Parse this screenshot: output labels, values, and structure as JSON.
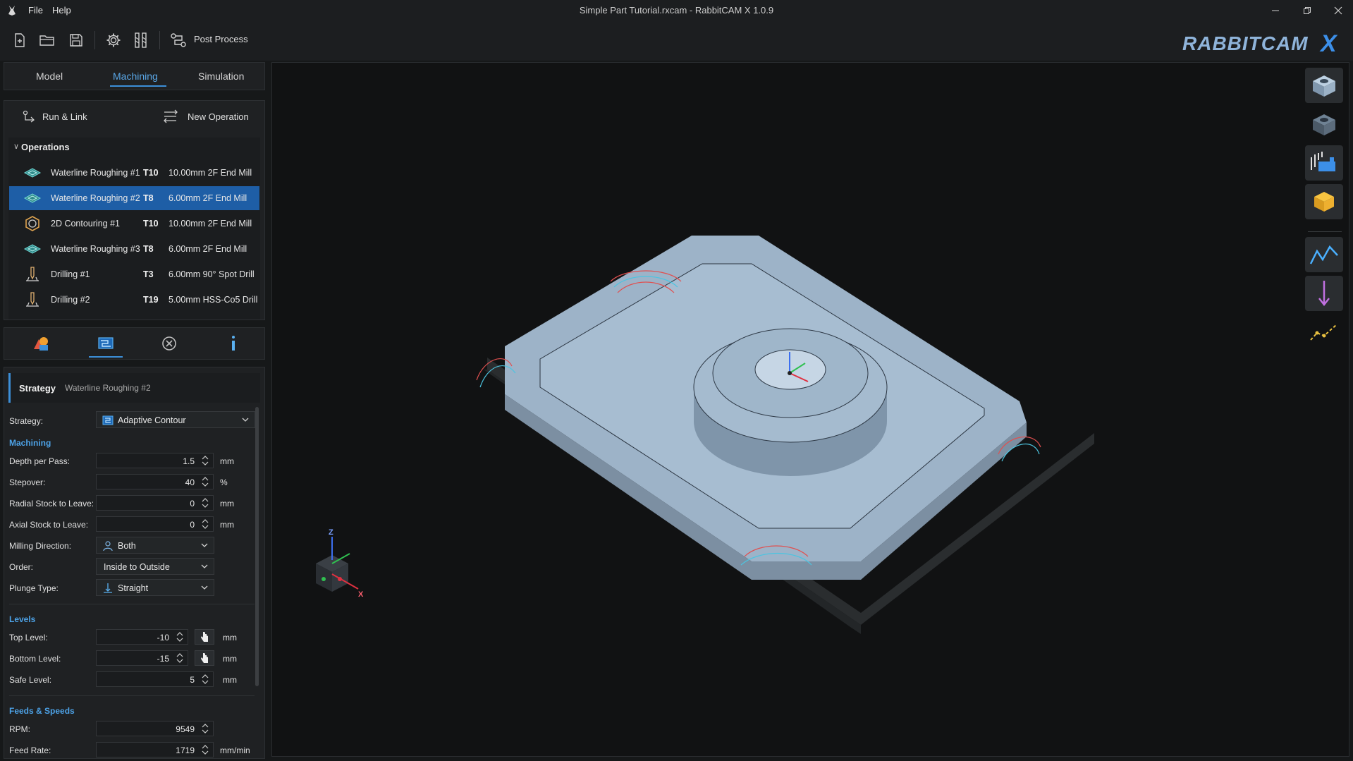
{
  "window": {
    "title": "Simple Part Tutorial.rxcam - RabbitCAM X 1.0.9",
    "menu": [
      "File",
      "Help"
    ],
    "controls": [
      "minimize",
      "restore",
      "close"
    ]
  },
  "toolbar": {
    "buttons": [
      "new-file-icon",
      "open-folder-icon",
      "save-icon",
      "settings-gear-icon",
      "tool-library-icon",
      "post-process-icon"
    ],
    "post_process_label": "Post Process",
    "logo_text": "RABBITCAM",
    "logo_suffix": "X"
  },
  "tabs": [
    "Model",
    "Machining",
    "Simulation"
  ],
  "active_tab": "Machining",
  "operations_panel": {
    "run_link_label": "Run & Link",
    "new_operation_label": "New Operation",
    "header": "Operations",
    "rows": [
      {
        "name": "Waterline Roughing #1",
        "tool": "T10",
        "desc": "10.00mm 2F End Mill",
        "icon": "waterline-icon",
        "selected": false
      },
      {
        "name": "Waterline Roughing #2",
        "tool": "T8",
        "desc": "6.00mm 2F End Mill",
        "icon": "waterline-icon",
        "selected": true
      },
      {
        "name": "2D Contouring #1",
        "tool": "T10",
        "desc": "10.00mm 2F End Mill",
        "icon": "contour-icon",
        "selected": false
      },
      {
        "name": "Waterline Roughing #3",
        "tool": "T8",
        "desc": "6.00mm 2F End Mill",
        "icon": "waterline-icon",
        "selected": false
      },
      {
        "name": "Drilling #1",
        "tool": "T3",
        "desc": "6.00mm 90° Spot Drill",
        "icon": "drill-icon",
        "selected": false
      },
      {
        "name": "Drilling #2",
        "tool": "T19",
        "desc": "5.00mm HSS-Co5 Drill",
        "icon": "drill-icon",
        "selected": false
      }
    ]
  },
  "icon_tabs": [
    "geometry-icon",
    "strategy-icon",
    "boundary-icon",
    "tool-icon"
  ],
  "strategy_panel": {
    "title": "Strategy",
    "subtitle": "Waterline Roughing #2",
    "strategy_label": "Strategy:",
    "strategy_value": "Adaptive Contour",
    "sections": {
      "machining": "Machining",
      "levels": "Levels",
      "feeds": "Feeds & Speeds"
    },
    "fields": {
      "depth": {
        "label": "Depth per Pass:",
        "value": "1.5",
        "unit": "mm"
      },
      "stepover": {
        "label": "Stepover:",
        "value": "40",
        "unit": "%"
      },
      "radial": {
        "label": "Radial Stock to Leave:",
        "value": "0",
        "unit": "mm"
      },
      "axial": {
        "label": "Axial Stock to Leave:",
        "value": "0",
        "unit": "mm"
      },
      "milling_dir": {
        "label": "Milling Direction:",
        "value": "Both"
      },
      "order": {
        "label": "Order:",
        "value": "Inside to Outside"
      },
      "plunge": {
        "label": "Plunge Type:",
        "value": "Straight"
      },
      "top": {
        "label": "Top Level:",
        "value": "-10",
        "unit": "mm"
      },
      "bottom": {
        "label": "Bottom Level:",
        "value": "-15",
        "unit": "mm"
      },
      "safe": {
        "label": "Safe Level:",
        "value": "5",
        "unit": "mm"
      },
      "rpm": {
        "label": "RPM:",
        "value": "9549"
      },
      "feed": {
        "label": "Feed Rate:",
        "value": "1719",
        "unit": "mm/min"
      }
    }
  },
  "viewport": {
    "axis_labels": {
      "z": "Z",
      "x": "X"
    }
  },
  "right_toolbar": [
    "stock-view-icon",
    "model-view-icon",
    "fixture-icon",
    "solid-stock-icon",
    "toolpath-icon",
    "plunge-arrow-icon",
    "linking-moves-icon"
  ],
  "colors": {
    "accent": "#3c8fd8",
    "selected_row": "#1e5ea6",
    "section_text": "#4da3e8",
    "background": "#161819"
  }
}
